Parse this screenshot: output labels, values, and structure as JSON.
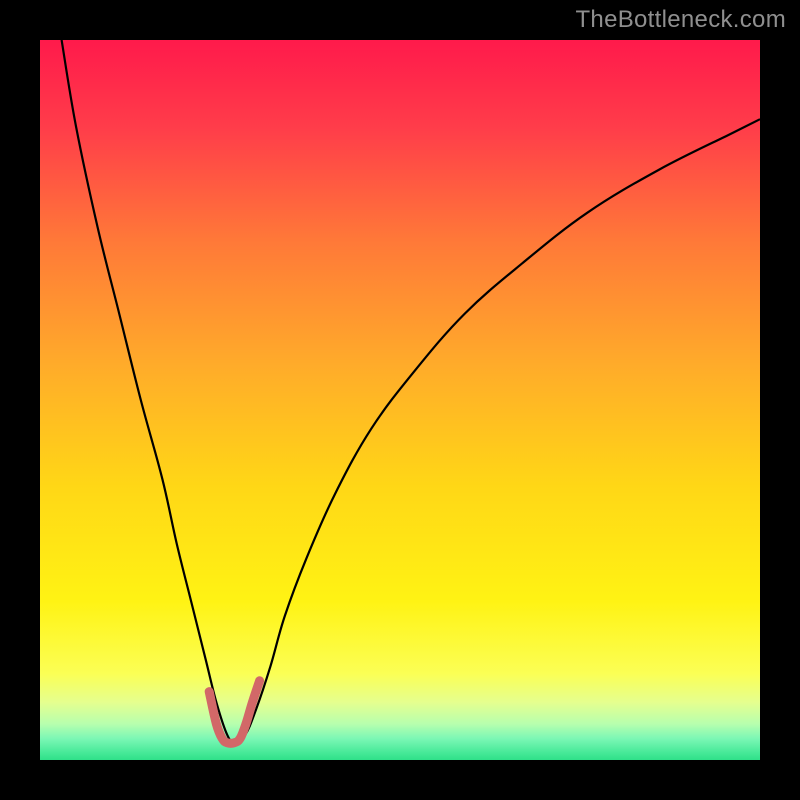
{
  "watermark": {
    "text": "TheBottleneck.com"
  },
  "gradient": {
    "stops": [
      {
        "pct": 0,
        "color": "#ff1a4b"
      },
      {
        "pct": 12,
        "color": "#ff3c4a"
      },
      {
        "pct": 28,
        "color": "#ff7938"
      },
      {
        "pct": 45,
        "color": "#ffab2a"
      },
      {
        "pct": 62,
        "color": "#ffd716"
      },
      {
        "pct": 78,
        "color": "#fff314"
      },
      {
        "pct": 88,
        "color": "#fbff55"
      },
      {
        "pct": 92,
        "color": "#e5ff8f"
      },
      {
        "pct": 95,
        "color": "#b7ffae"
      },
      {
        "pct": 97,
        "color": "#7cf7b5"
      },
      {
        "pct": 99,
        "color": "#46e998"
      },
      {
        "pct": 100,
        "color": "#2fe089"
      }
    ]
  },
  "chart_data": {
    "type": "line",
    "title": "",
    "xlabel": "",
    "ylabel": "",
    "xlim": [
      0,
      100
    ],
    "ylim": [
      0,
      100
    ],
    "series": [
      {
        "name": "bottleneck-curve",
        "stroke": "#000000",
        "stroke_width": 2.2,
        "x": [
          3,
          5,
          8,
          11,
          14,
          17,
          19,
          21,
          23,
          24.5,
          26,
          27,
          28.5,
          30,
          32,
          34,
          37,
          41,
          46,
          52,
          59,
          67,
          76,
          86,
          96,
          100
        ],
        "y": [
          100,
          88,
          74,
          62,
          50,
          39,
          30,
          22,
          14,
          8,
          3.5,
          2.5,
          3.5,
          7,
          13,
          20,
          28,
          37,
          46,
          54,
          62,
          69,
          76,
          82,
          87,
          89
        ]
      },
      {
        "name": "valley-highlight",
        "stroke": "#d26868",
        "stroke_width": 9,
        "linecap": "round",
        "x": [
          23.5,
          24.5,
          25.3,
          26,
          27,
          27.8,
          28.6,
          29.5,
          30.5
        ],
        "y": [
          9.5,
          5,
          3,
          2.4,
          2.4,
          3,
          5,
          8,
          11
        ]
      }
    ]
  }
}
